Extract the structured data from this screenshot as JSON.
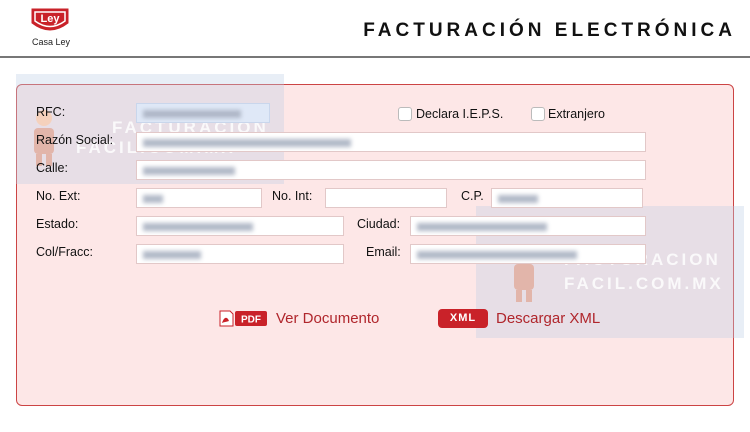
{
  "header": {
    "logo_text": "Casa Ley",
    "logo_mark": "Ley",
    "title": "FACTURACIÓN ELECTRÓNICA"
  },
  "watermark": {
    "line1": "FACTURACION",
    "line2": "FACIL.COM.MX"
  },
  "form": {
    "rfc_label": "RFC:",
    "razon_label": "Razón Social:",
    "calle_label": "Calle:",
    "noext_label": "No. Ext:",
    "noint_label": "No. Int:",
    "cp_label": "C.P.",
    "estado_label": "Estado:",
    "ciudad_label": "Ciudad:",
    "colfracc_label": "Col/Fracc:",
    "email_label": "Email:",
    "ieps_label": "Declara I.E.P.S.",
    "extranjero_label": "Extranjero"
  },
  "actions": {
    "pdf_badge": "PDF",
    "view_label": "Ver Documento",
    "xml_badge": "XML",
    "download_label": "Descargar XML"
  },
  "colors": {
    "brand_red": "#c92229",
    "panel_bg": "#fde7e7",
    "panel_border": "#cc4444"
  }
}
